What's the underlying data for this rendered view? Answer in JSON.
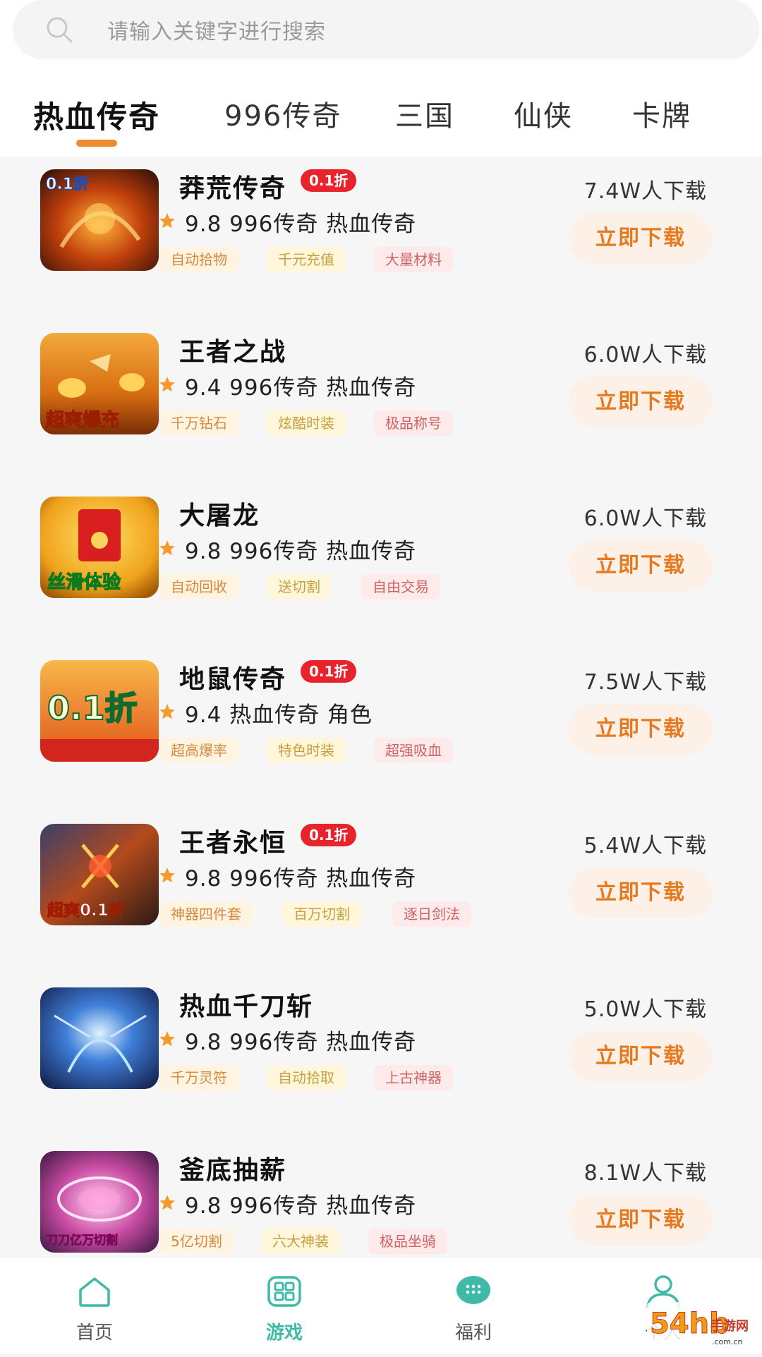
{
  "search": {
    "placeholder": "请输入关键字进行搜索"
  },
  "tabs": [
    {
      "label": "热血传奇",
      "active": true
    },
    {
      "label": "996传奇"
    },
    {
      "label": "三国"
    },
    {
      "label": "仙侠"
    },
    {
      "label": "卡牌"
    }
  ],
  "games": [
    {
      "title": "莽荒传奇",
      "badge": "0.1折",
      "rating": "9.8",
      "meta": "9.8 996传奇 热血传奇",
      "tags": [
        "自动拾物",
        "千元充值",
        "大量材料"
      ],
      "downloads": "7.4W人下载",
      "button": "立即下载",
      "thumb_text": "0.1折"
    },
    {
      "title": "王者之战",
      "badge": "",
      "rating": "9.4",
      "meta": "9.4 996传奇 热血传奇",
      "tags": [
        "千万钻石",
        "炫酷时装",
        "极品称号"
      ],
      "downloads": "6.0W人下载",
      "button": "立即下载",
      "thumb_text": "超爽爆充"
    },
    {
      "title": "大屠龙",
      "badge": "",
      "rating": "9.8",
      "meta": "9.8 996传奇 热血传奇",
      "tags": [
        "自动回收",
        "送切割",
        "自由交易"
      ],
      "downloads": "6.0W人下载",
      "button": "立即下载",
      "thumb_text": "丝滑体验"
    },
    {
      "title": "地鼠传奇",
      "badge": "0.1折",
      "rating": "9.4",
      "meta": "9.4 热血传奇 角色",
      "tags": [
        "超高爆率",
        "特色时装",
        "超强吸血"
      ],
      "downloads": "7.5W人下载",
      "button": "立即下载",
      "thumb_text": "0.1折"
    },
    {
      "title": "王者永恒",
      "badge": "0.1折",
      "rating": "9.8",
      "meta": "9.8 996传奇 热血传奇",
      "tags": [
        "神器四件套",
        "百万切割",
        "逐日剑法"
      ],
      "downloads": "5.4W人下载",
      "button": "立即下载",
      "thumb_text": "超爽0.1折"
    },
    {
      "title": "热血千刀斩",
      "badge": "",
      "rating": "9.8",
      "meta": "9.8 996传奇 热血传奇",
      "tags": [
        "千万灵符",
        "自动拾取",
        "上古神器"
      ],
      "downloads": "5.0W人下载",
      "button": "立即下载",
      "thumb_text": ""
    },
    {
      "title": "釜底抽薪",
      "badge": "",
      "rating": "9.8",
      "meta": "9.8 996传奇 热血传奇",
      "tags": [
        "5亿切割",
        "六大神装",
        "极品坐骑"
      ],
      "downloads": "8.1W人下载",
      "button": "立即下载",
      "thumb_text": "刀刀亿万切割"
    }
  ],
  "bottom_nav": [
    {
      "label": "首页",
      "icon": "home-icon"
    },
    {
      "label": "游戏",
      "icon": "games-icon",
      "active": true
    },
    {
      "label": "福利",
      "icon": "welfare-icon"
    },
    {
      "label": "个人",
      "icon": "user-icon"
    }
  ],
  "watermark": {
    "text": "54hb手游网",
    "sub": "www.54hb.com.cn"
  },
  "colors": {
    "accent": "#f08a2e",
    "teal": "#3fb9a8",
    "badge": "#e8232b"
  }
}
